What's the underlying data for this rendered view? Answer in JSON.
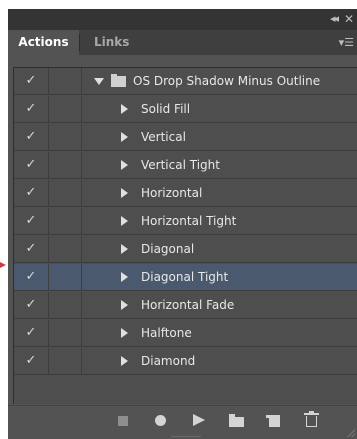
{
  "panel": {
    "collapse_icon": "double-chevron-left-icon",
    "close_icon": "close-icon",
    "menu_icon": "panel-menu-icon"
  },
  "tabs": [
    {
      "label": "Actions",
      "active": true
    },
    {
      "label": "Links",
      "active": false
    }
  ],
  "action_set": {
    "check": "✓",
    "expanded": true,
    "label": "OS Drop Shadow Minus Outline"
  },
  "actions": [
    {
      "check": "✓",
      "label": "Solid Fill",
      "selected": false
    },
    {
      "check": "✓",
      "label": "Vertical",
      "selected": false
    },
    {
      "check": "✓",
      "label": "Vertical Tight",
      "selected": false
    },
    {
      "check": "✓",
      "label": "Horizontal",
      "selected": false
    },
    {
      "check": "✓",
      "label": "Horizontal Tight",
      "selected": false
    },
    {
      "check": "✓",
      "label": "Diagonal",
      "selected": false
    },
    {
      "check": "✓",
      "label": "Diagonal Tight",
      "selected": true
    },
    {
      "check": "✓",
      "label": "Horizontal Fade",
      "selected": false
    },
    {
      "check": "✓",
      "label": "Halftone",
      "selected": false
    },
    {
      "check": "✓",
      "label": "Diamond",
      "selected": false
    }
  ],
  "toolbar": [
    "stop-icon",
    "record-icon",
    "play-icon",
    "new-set-icon",
    "new-action-icon",
    "trash-icon"
  ],
  "colors": {
    "panel": "#535353",
    "titlebar": "#343434",
    "selection": "#4a596d",
    "pointer": "#d23b3b"
  }
}
